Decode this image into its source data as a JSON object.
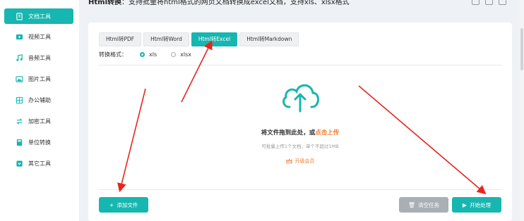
{
  "sidebar": {
    "items": [
      {
        "label": "文档工具",
        "icon": "document-icon",
        "active": true
      },
      {
        "label": "视频工具",
        "icon": "video-icon",
        "active": false
      },
      {
        "label": "音频工具",
        "icon": "music-icon",
        "active": false
      },
      {
        "label": "图片工具",
        "icon": "image-icon",
        "active": false
      },
      {
        "label": "办公辅助",
        "icon": "office-icon",
        "active": false
      },
      {
        "label": "加密工具",
        "icon": "encrypt-icon",
        "active": false
      },
      {
        "label": "单位转换",
        "icon": "unit-icon",
        "active": false
      },
      {
        "label": "其它工具",
        "icon": "other-icon",
        "active": false
      }
    ]
  },
  "header": {
    "title_bold": "Html转换",
    "title_rest": "：支持批量将html格式的网页文档转换成excel文档，支持xls、xlsx格式"
  },
  "tabs": [
    {
      "label": "Html转PDF",
      "active": false
    },
    {
      "label": "Html转Word",
      "active": false
    },
    {
      "label": "Html转Excel",
      "active": true
    },
    {
      "label": "Html转Markdown",
      "active": false
    }
  ],
  "format": {
    "label": "转换格式：",
    "options": [
      {
        "label": "xls",
        "selected": true
      },
      {
        "label": "xlsx",
        "selected": false
      }
    ]
  },
  "upload": {
    "main_prefix": "将文件拖到此处，或",
    "main_link": "点击上传",
    "sub": "可批量上传1个文档，单个不超过1MB",
    "vip": "开级会员"
  },
  "buttons": {
    "add": "添加文件",
    "clear": "清空任务",
    "start": "开始处理"
  },
  "colors": {
    "accent": "#17b6b0",
    "highlight": "#f07a2a",
    "annotation": "#e8241c"
  }
}
